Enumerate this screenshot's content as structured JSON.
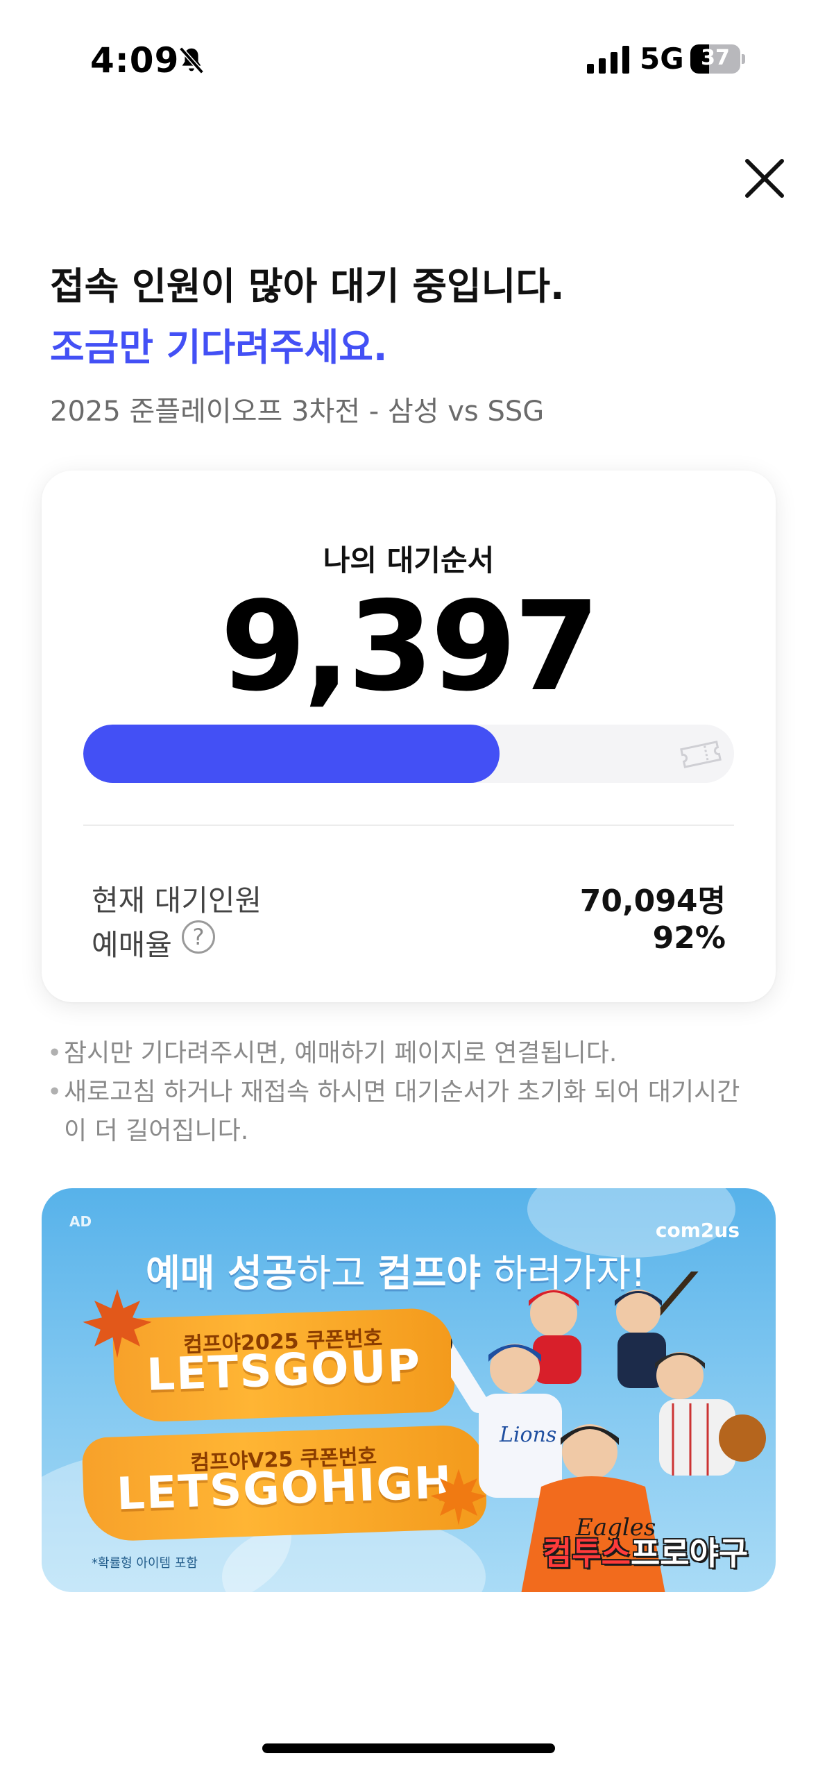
{
  "status_bar": {
    "time": "4:09",
    "network": "5G",
    "battery": "37",
    "battery_level": 0.37
  },
  "header": {
    "headline": "접속 인원이 많아 대기 중입니다.",
    "headline_accent": "조금만 기다려주세요.",
    "event": "2025 준플레이오프 3차전 - 삼성 vs SSG"
  },
  "queue": {
    "label": "나의 대기순서",
    "position": "9,397",
    "progress": 0.64,
    "current_waiting_label": "현재 대기인원",
    "current_waiting_value": "70,094명",
    "booking_rate_label": "예매율",
    "booking_rate_value": "92%",
    "help_symbol": "?"
  },
  "notes": [
    "잠시만 기다려주시면, 예매하기 페이지로 연결됩니다.",
    "새로고침 하거나 재접속 하시면 대기순서가 초기화 되어 대기시간",
    "이 더 길어집니다."
  ],
  "ad": {
    "tag": "AD",
    "brand": "com2us",
    "headline_bold1": "예매 성공",
    "headline_thin1": "하고 ",
    "headline_bold2": "컴프야",
    "headline_thin2": " 하러가자!",
    "coupon1_title": "컴프야2025 쿠폰번호",
    "coupon1_code": "LETSGOUP",
    "coupon2_title": "컴프야V25 쿠폰번호",
    "coupon2_code": "LETSGOHIGH",
    "footnote": "*확률형 아이템 포함",
    "game_title_red": "컴투스",
    "game_title_white": "프로야구"
  },
  "colors": {
    "accent": "#4350f5",
    "muted": "#8a8a8a"
  }
}
